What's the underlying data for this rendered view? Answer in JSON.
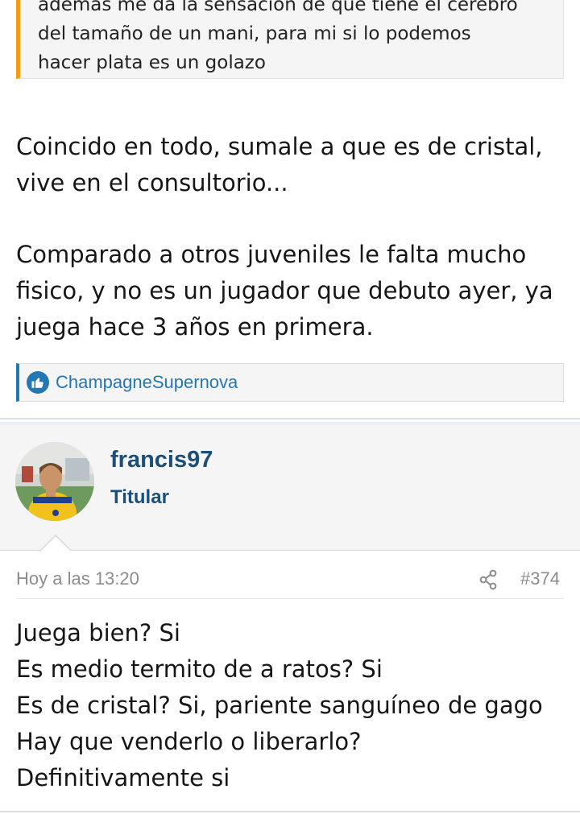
{
  "quoted_post": {
    "lines": [
      "ademas me da la sensación de que tiene el cerebro",
      "del tamaño de un mani, para mi si lo podemos",
      "hacer plata es un golazo"
    ]
  },
  "post_1": {
    "paragraph_1": [
      "Coincido en todo, sumale a que es de cristal,",
      "vive en el consultorio..."
    ],
    "paragraph_2": [
      "Comparado a otros juveniles le falta mucho",
      "fisico, y no es un jugador que debuto ayer, ya",
      "juega hace 3 años en primera."
    ]
  },
  "reactions": {
    "icon": "thumbs-up-icon",
    "user": "ChampagneSupernova",
    "color": "#2577b1"
  },
  "post_2": {
    "author": {
      "username": "francis97",
      "title": "Titular"
    },
    "date": "Hoy a las 13:20",
    "share_icon": "share-icon",
    "post_number": "#374",
    "lines": [
      "Juega bien? Si",
      "Es medio termito de a ratos? Si",
      "Es de cristal? Si, pariente sanguíneo de gago",
      "Hay que venderlo o liberarlo?",
      "Definitivamente si"
    ]
  },
  "colors": {
    "quote_accent": "#f39c12",
    "username": "#1b4f7a",
    "meta_text": "#8c8c8c"
  }
}
